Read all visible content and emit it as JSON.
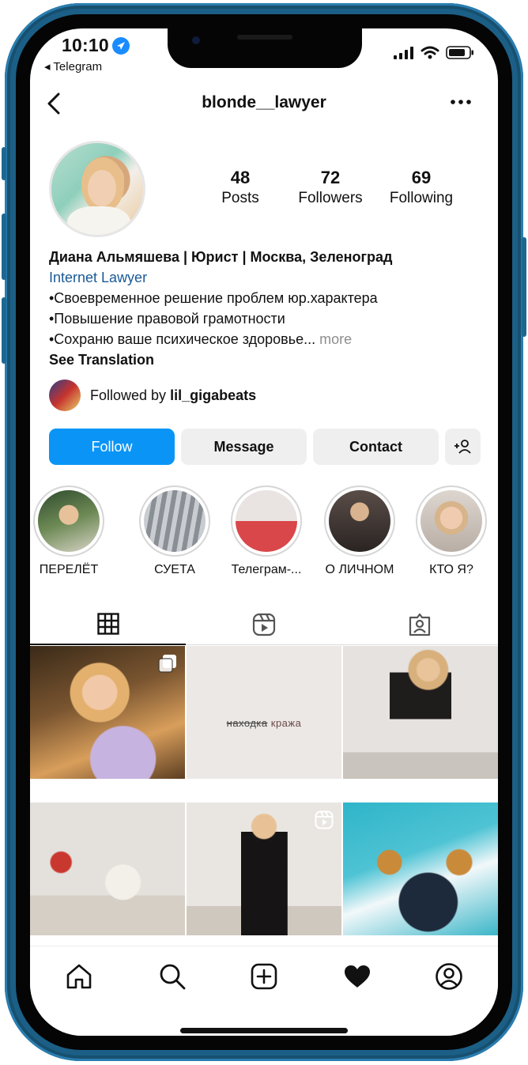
{
  "status_bar": {
    "time": "10:10",
    "back_app": "◂ Telegram"
  },
  "header": {
    "username": "blonde__lawyer"
  },
  "stats": [
    {
      "value": "48",
      "label": "Posts"
    },
    {
      "value": "72",
      "label": "Followers"
    },
    {
      "value": "69",
      "label": "Following"
    }
  ],
  "bio": {
    "name": "Диана Альмяшева | Юрист | Москва, Зеленоград",
    "category": "Internet Lawyer",
    "line1": "•Своевременное решение проблем юр.характера",
    "line2": "•Повышение правовой грамотности",
    "line3": "•Сохраню ваше психическое здоровье...",
    "more": "more",
    "translate": "See Translation"
  },
  "followed_by": {
    "prefix": "Followed by",
    "user": "lil_gigabeats"
  },
  "actions": {
    "follow": "Follow",
    "message": "Message",
    "contact": "Contact"
  },
  "highlights": [
    {
      "label": "ПЕРЕЛЁТ"
    },
    {
      "label": "СУЕТА"
    },
    {
      "label": "Телеграм-..."
    },
    {
      "label": "О ЛИЧНОМ"
    },
    {
      "label": "КТО Я?"
    }
  ],
  "grid": {
    "post2_struck": "находка",
    "post2_word": "кража"
  },
  "colors": {
    "accent": "#0a95f6",
    "link": "#1a5a96",
    "frame": "#1c5f86"
  }
}
